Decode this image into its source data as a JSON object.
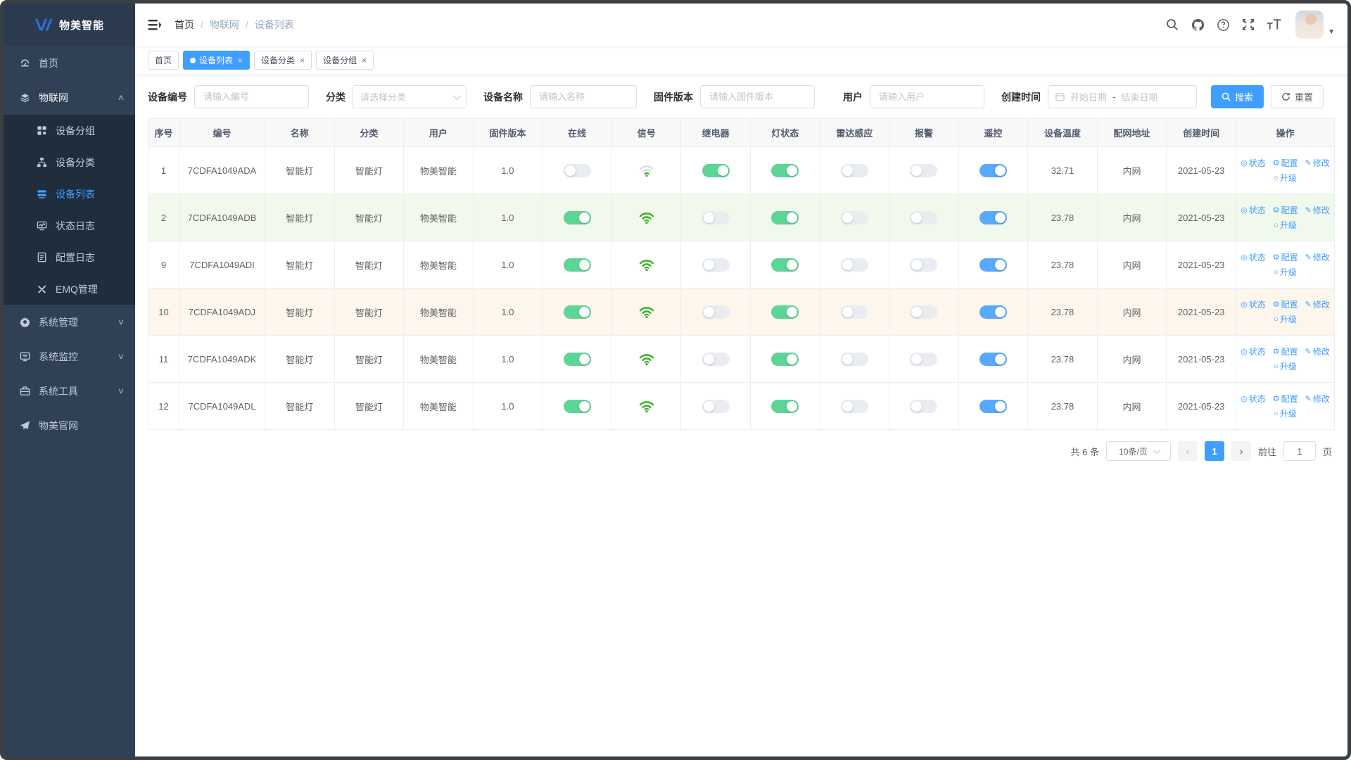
{
  "brand": {
    "name": "物美智能"
  },
  "sidebar": {
    "items": [
      {
        "id": "home",
        "label": "首页",
        "icon": "dashboard-icon"
      },
      {
        "id": "iot",
        "label": "物联网",
        "icon": "iot-icon",
        "expanded": true,
        "children": [
          {
            "id": "device-group",
            "label": "设备分组",
            "icon": "grid-icon"
          },
          {
            "id": "device-category",
            "label": "设备分类",
            "icon": "tree-icon"
          },
          {
            "id": "device-list",
            "label": "设备列表",
            "icon": "list-icon",
            "active": true
          },
          {
            "id": "status-log",
            "label": "状态日志",
            "icon": "chart-icon"
          },
          {
            "id": "config-log",
            "label": "配置日志",
            "icon": "doc-icon"
          },
          {
            "id": "emq-manage",
            "label": "EMQ管理",
            "icon": "connections-icon"
          }
        ]
      },
      {
        "id": "system-manage",
        "label": "系统管理",
        "icon": "gear-icon",
        "collapsed": true
      },
      {
        "id": "system-monitor",
        "label": "系统监控",
        "icon": "monitor-icon",
        "collapsed": true
      },
      {
        "id": "system-tools",
        "label": "系统工具",
        "icon": "toolbox-icon",
        "collapsed": true
      },
      {
        "id": "official-site",
        "label": "物美官网",
        "icon": "paper-plane-icon"
      }
    ]
  },
  "navbar": {
    "breadcrumb": [
      "首页",
      "物联网",
      "设备列表"
    ]
  },
  "tabs": [
    {
      "label": "首页",
      "active": false,
      "closable": false
    },
    {
      "label": "设备列表",
      "active": true,
      "closable": true
    },
    {
      "label": "设备分类",
      "active": false,
      "closable": true
    },
    {
      "label": "设备分组",
      "active": false,
      "closable": true
    }
  ],
  "filters": {
    "device_code": {
      "label": "设备编号",
      "placeholder": "请输入编号"
    },
    "category": {
      "label": "分类",
      "placeholder": "请选择分类"
    },
    "device_name": {
      "label": "设备名称",
      "placeholder": "请输入名称"
    },
    "firmware": {
      "label": "固件版本",
      "placeholder": "请输入固件版本"
    },
    "user": {
      "label": "用户",
      "placeholder": "请输入用户"
    },
    "created": {
      "label": "创建时间",
      "start_placeholder": "开始日期",
      "separator": "-",
      "end_placeholder": "结束日期"
    },
    "search_label": "搜索",
    "reset_label": "重置"
  },
  "table": {
    "columns": [
      {
        "key": "index",
        "label": "序号"
      },
      {
        "key": "code",
        "label": "编号"
      },
      {
        "key": "name",
        "label": "名称"
      },
      {
        "key": "category",
        "label": "分类"
      },
      {
        "key": "user",
        "label": "用户"
      },
      {
        "key": "firmware",
        "label": "固件版本"
      },
      {
        "key": "online",
        "label": "在线",
        "type": "switch"
      },
      {
        "key": "signal",
        "label": "信号",
        "type": "wifi"
      },
      {
        "key": "relay",
        "label": "继电器",
        "type": "switch"
      },
      {
        "key": "light",
        "label": "灯状态",
        "type": "switch"
      },
      {
        "key": "radar",
        "label": "雷达感应",
        "type": "switch"
      },
      {
        "key": "alarm",
        "label": "报警",
        "type": "switch"
      },
      {
        "key": "remote",
        "label": "遥控",
        "type": "switch-blue"
      },
      {
        "key": "temperature",
        "label": "设备温度"
      },
      {
        "key": "network",
        "label": "配网地址"
      },
      {
        "key": "created",
        "label": "创建时间"
      },
      {
        "key": "actions",
        "label": "操作",
        "type": "actions"
      }
    ],
    "actions": [
      {
        "icon": "eye-icon",
        "glyph": "◎",
        "label": "状态"
      },
      {
        "icon": "config-gear-icon",
        "glyph": "⚙",
        "label": "配置"
      },
      {
        "icon": "edit-pencil-icon",
        "glyph": "✎",
        "label": "修改"
      },
      {
        "icon": "upgrade-icon",
        "glyph": "○",
        "label": "升级"
      }
    ],
    "rows": [
      {
        "index": "1",
        "code": "7CDFA1049ADA",
        "name": "智能灯",
        "category": "智能灯",
        "user": "物美智能",
        "firmware": "1.0",
        "online": false,
        "signal": "weak",
        "relay": true,
        "light": true,
        "radar": false,
        "alarm": false,
        "remote": true,
        "temperature": "32.71",
        "network": "内网",
        "created": "2021-05-23",
        "row_state": "none"
      },
      {
        "index": "2",
        "code": "7CDFA1049ADB",
        "name": "智能灯",
        "category": "智能灯",
        "user": "物美智能",
        "firmware": "1.0",
        "online": true,
        "signal": "strong",
        "relay": false,
        "light": true,
        "radar": false,
        "alarm": false,
        "remote": true,
        "temperature": "23.78",
        "network": "内网",
        "created": "2021-05-23",
        "row_state": "success"
      },
      {
        "index": "9",
        "code": "7CDFA1049ADI",
        "name": "智能灯",
        "category": "智能灯",
        "user": "物美智能",
        "firmware": "1.0",
        "online": true,
        "signal": "strong",
        "relay": false,
        "light": true,
        "radar": false,
        "alarm": false,
        "remote": true,
        "temperature": "23.78",
        "network": "内网",
        "created": "2021-05-23",
        "row_state": "none"
      },
      {
        "index": "10",
        "code": "7CDFA1049ADJ",
        "name": "智能灯",
        "category": "智能灯",
        "user": "物美智能",
        "firmware": "1.0",
        "online": true,
        "signal": "strong",
        "relay": false,
        "light": true,
        "radar": false,
        "alarm": false,
        "remote": true,
        "temperature": "23.78",
        "network": "内网",
        "created": "2021-05-23",
        "row_state": "warning"
      },
      {
        "index": "11",
        "code": "7CDFA1049ADK",
        "name": "智能灯",
        "category": "智能灯",
        "user": "物美智能",
        "firmware": "1.0",
        "online": true,
        "signal": "strong",
        "relay": false,
        "light": true,
        "radar": false,
        "alarm": false,
        "remote": true,
        "temperature": "23.78",
        "network": "内网",
        "created": "2021-05-23",
        "row_state": "none"
      },
      {
        "index": "12",
        "code": "7CDFA1049ADL",
        "name": "智能灯",
        "category": "智能灯",
        "user": "物美智能",
        "firmware": "1.0",
        "online": true,
        "signal": "strong",
        "relay": false,
        "light": true,
        "radar": false,
        "alarm": false,
        "remote": true,
        "temperature": "23.78",
        "network": "内网",
        "created": "2021-05-23",
        "row_state": "none"
      }
    ]
  },
  "pagination": {
    "total_text": "共 6 条",
    "page_size_label": "10条/页",
    "prev": "‹",
    "current_page": "1",
    "next": "›",
    "goto_label": "前往",
    "goto_value": "1",
    "page_suffix": "页"
  },
  "colors": {
    "accent": "#409EFF",
    "toggle_green": "#5cd596",
    "toggle_blue": "#57aaff",
    "wifi_green": "#38b42b",
    "row_success_bg": "#f0f9eb",
    "row_warning_bg": "#fdf6ec",
    "sidebar_bg": "#304156",
    "submenu_bg": "#1f2d3d"
  }
}
